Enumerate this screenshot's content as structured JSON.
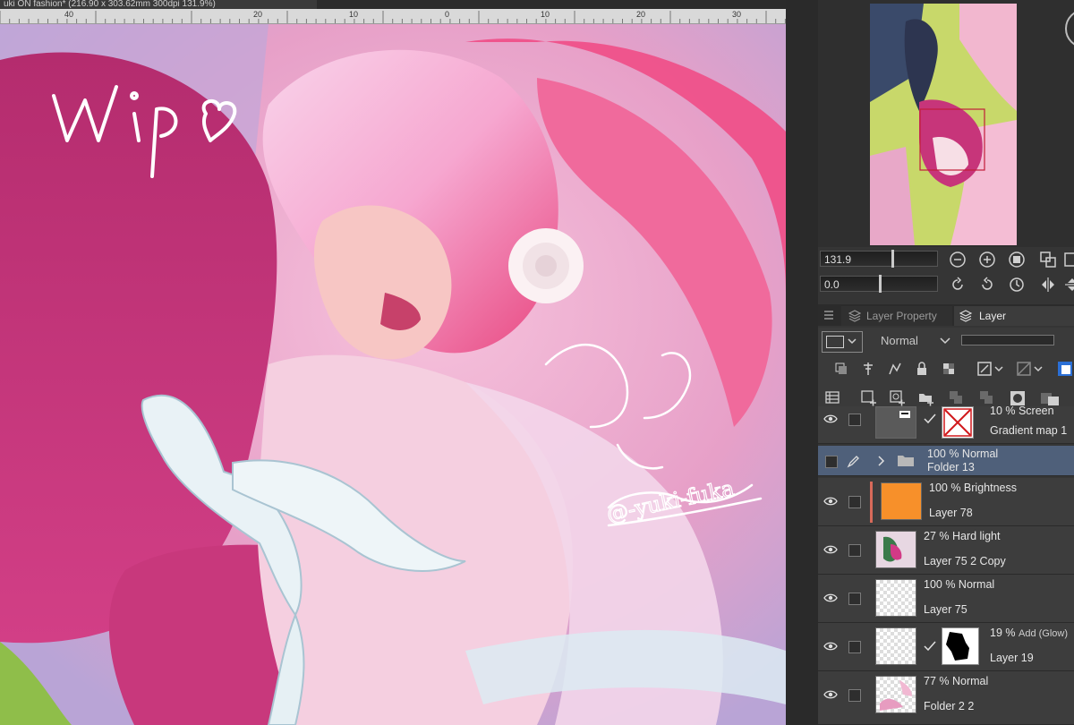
{
  "window": {
    "title": "uki ON fashion* (216.90 x 303.62mm 300dpi 131.9%)"
  },
  "ruler": {
    "labels": [
      "40",
      "20",
      "10",
      "0",
      "10",
      "20",
      "30"
    ]
  },
  "canvas": {
    "signature": "wip",
    "watermark": "@-yuki-fuka"
  },
  "navigator": {
    "zoom_value": "131.9",
    "rotation_value": "0.0"
  },
  "tabs": {
    "layer_property": "Layer Property",
    "layer": "Layer"
  },
  "blend": {
    "mode": "Normal"
  },
  "layers": [
    {
      "mode": "10 % Screen",
      "name": "Gradient map 1"
    },
    {
      "mode": "100 % Normal",
      "name": "Folder 13"
    },
    {
      "mode": "100 % Brightness",
      "name": "Layer 78"
    },
    {
      "mode": "27 % Hard light",
      "name": "Layer 75 2 Copy"
    },
    {
      "mode": "100 % Normal",
      "name": "Layer 75"
    },
    {
      "mode": "19 %",
      "mode_extra": "Add (Glow)",
      "name": "Layer 19"
    },
    {
      "mode": "77 % Normal",
      "name": "Folder 2 2"
    }
  ],
  "colors": {
    "accent": "#4f607a",
    "panel_bg": "#353535",
    "orange_layer": "#f7902a"
  }
}
